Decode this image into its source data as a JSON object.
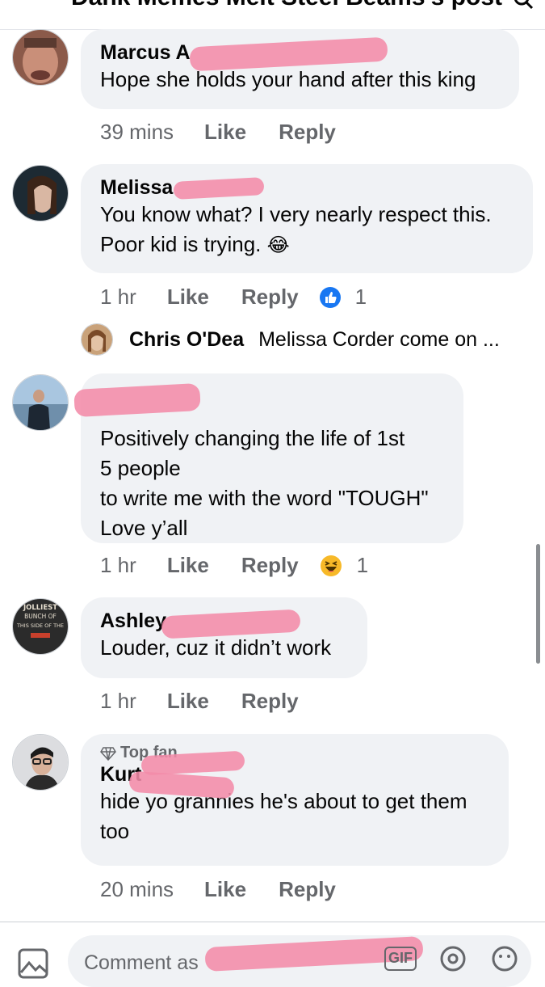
{
  "header": {
    "title": "Dank Memes Melt Steel Beams's post",
    "search_icon": "search-icon"
  },
  "comments": [
    {
      "name": "Marcus A",
      "text": "Hope she holds your hand after this king",
      "time": "39 mins",
      "like": "Like",
      "reply": "Reply"
    },
    {
      "name": "Melissa",
      "text": "You know what? I very nearly respect this.\nPoor kid is trying.",
      "emoji": "😂",
      "time": "1 hr",
      "like": "Like",
      "reply": "Reply",
      "reaction_icon": "thumbs-up-icon",
      "reaction_count": "1"
    },
    {
      "name": "",
      "text": "Positively changing the life of 1st\n5 people\nto write me with the word \"TOUGH\"\nLove y’all",
      "time": "1 hr",
      "like": "Like",
      "reply": "Reply",
      "reaction_icon": "haha-icon",
      "reaction_count": "1"
    },
    {
      "name": "Ashley",
      "text": "Louder, cuz it didn’t work",
      "time": "1 hr",
      "like": "Like",
      "reply": "Reply",
      "avatar_text": [
        "JOLLIEST",
        "BUNCH OF",
        "THIS SIDE OF THE"
      ]
    },
    {
      "badge": "Top fan",
      "badge_icon": "diamond-icon",
      "name": "Kurt",
      "text": "hide yo grannies he's about to get them\ntoo",
      "time": "20 mins",
      "like": "Like",
      "reply": "Reply"
    }
  ],
  "reply_preview": {
    "name": "Chris O'Dea",
    "text": "Melissa Corder come on ..."
  },
  "composer": {
    "placeholder": "Comment as",
    "gif_label": "GIF"
  },
  "colors": {
    "bubble": "#f0f2f5",
    "meta": "#65676b",
    "like_blue": "#1877f2",
    "redaction": "#f38ba8"
  }
}
